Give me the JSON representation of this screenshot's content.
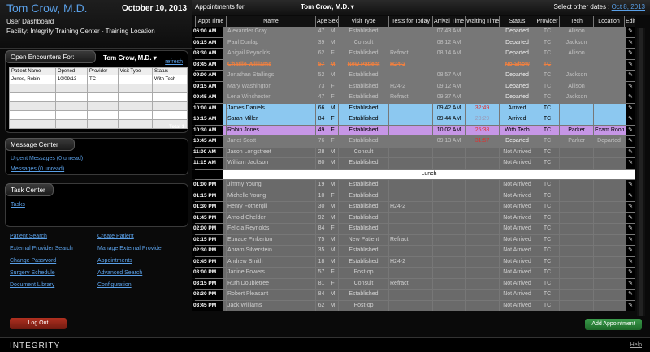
{
  "header": {
    "doctor": "Tom Crow, M.D.",
    "date": "October 10, 2013",
    "dashboard": "User Dashboard",
    "facility": "Facility: Integrity Training Center - Training Location"
  },
  "encounters": {
    "title": "Open Encounters For:",
    "provider": "Tom Crow, M.D.",
    "refresh": "refresh",
    "columns": [
      "Patient Name",
      "Opened",
      "Provider",
      "Visit Type",
      "Status"
    ],
    "rows": [
      [
        "Jones, Robin",
        "10/09/13",
        "TC",
        "",
        "With Tech"
      ]
    ],
    "total": "Total 1"
  },
  "message_center": {
    "title": "Message Center",
    "urgent": "Urgent Messages (0 unread)",
    "messages": "Messages (0 unread)"
  },
  "task_center": {
    "title": "Task Center",
    "tasks": "Tasks"
  },
  "links": {
    "col1": [
      "Patient Search",
      "External Provider Search",
      "Change Password",
      "Surgery Schedule",
      "Document Library"
    ],
    "col2": [
      "Create Patient",
      "Manage External Provider",
      "Appointments",
      "Advanced Search",
      "Configuration"
    ]
  },
  "logout": "Log Out",
  "appointments": {
    "for_label": "Appointments for:",
    "provider": "Tom Crow, M.D.",
    "other_dates": "Select other dates :",
    "other_date_link": "Oct 8, 2013",
    "columns": [
      "Appt Time",
      "Name",
      "Age",
      "Sex",
      "Visit Type",
      "Tests for Today",
      "Arrival Time",
      "Waiting Time",
      "Status",
      "Provider",
      "Tech",
      "Location",
      "Edit"
    ],
    "rows": [
      {
        "time": "06:00 AM",
        "name": "Alexander Gray",
        "age": "47",
        "sex": "M",
        "visit": "Established",
        "tests": "",
        "arrival": "07:43 AM",
        "wait": "",
        "status": "Departed",
        "provider": "TC",
        "tech": "Allison",
        "location": "",
        "type": "departed"
      },
      {
        "time": "08:15 AM",
        "name": "Paul Dunlap",
        "age": "39",
        "sex": "M",
        "visit": "Consult",
        "tests": "",
        "arrival": "08:12 AM",
        "wait": "",
        "status": "Departed",
        "provider": "TC",
        "tech": "Jackson",
        "location": "",
        "type": "departed"
      },
      {
        "time": "08:30 AM",
        "name": "Abigail Reynolds",
        "age": "62",
        "sex": "F",
        "visit": "Established",
        "tests": "Refract",
        "arrival": "08:14 AM",
        "wait": "",
        "status": "Departed",
        "provider": "TC",
        "tech": "Allison",
        "location": "",
        "type": "departed"
      },
      {
        "time": "08:45 AM",
        "name": "Charlie Williams",
        "age": "57",
        "sex": "M",
        "visit": "New Patient",
        "tests": "H24-2",
        "arrival": "",
        "wait": "",
        "status": "No-Show",
        "provider": "TC",
        "tech": "",
        "location": "",
        "type": "noshow"
      },
      {
        "time": "09:00 AM",
        "name": "Jonathan Stallings",
        "age": "52",
        "sex": "M",
        "visit": "Established",
        "tests": "",
        "arrival": "08:57 AM",
        "wait": "",
        "status": "Departed",
        "provider": "TC",
        "tech": "Jackson",
        "location": "",
        "type": "departed"
      },
      {
        "time": "09:15 AM",
        "name": "Mary Washington",
        "age": "73",
        "sex": "F",
        "visit": "Established",
        "tests": "H24-2",
        "arrival": "09:12 AM",
        "wait": "",
        "status": "Departed",
        "provider": "TC",
        "tech": "Allison",
        "location": "",
        "type": "departed"
      },
      {
        "time": "09:45 AM",
        "name": "Lena Winchester",
        "age": "47",
        "sex": "F",
        "visit": "Established",
        "tests": "Refract",
        "arrival": "09:37 AM",
        "wait": "",
        "status": "Departed",
        "provider": "TC",
        "tech": "Jackson",
        "location": "",
        "type": "departed"
      },
      {
        "time": "10:00 AM",
        "name": "James Daniels",
        "age": "66",
        "sex": "M",
        "visit": "Established",
        "tests": "",
        "arrival": "09:42 AM",
        "wait": "32:49",
        "status": "Arrived",
        "provider": "TC",
        "tech": "",
        "location": "",
        "type": "arrived"
      },
      {
        "time": "10:15 AM",
        "name": "Sarah Miller",
        "age": "84",
        "sex": "F",
        "visit": "Established",
        "tests": "",
        "arrival": "09:44 AM",
        "wait": "23:29",
        "status": "Arrived",
        "provider": "TC",
        "tech": "",
        "location": "",
        "type": "arrived"
      },
      {
        "time": "10:30 AM",
        "name": "Robin Jones",
        "age": "49",
        "sex": "F",
        "visit": "Established",
        "tests": "",
        "arrival": "10:02 AM",
        "wait": "25:38",
        "status": "With Tech",
        "provider": "TC",
        "tech": "Parker",
        "location": "Exam Room",
        "type": "tech"
      },
      {
        "time": "10:45 AM",
        "name": "Janet Scott",
        "age": "76",
        "sex": "F",
        "visit": "Established",
        "tests": "",
        "arrival": "09:13 AM",
        "wait": "31:57",
        "status": "Departed",
        "provider": "TC",
        "tech": "Parker",
        "location": "Departed",
        "type": "departed"
      },
      {
        "time": "11:00 AM",
        "name": "Jason Longstreet",
        "age": "28",
        "sex": "M",
        "visit": "Consult",
        "tests": "",
        "arrival": "",
        "wait": "",
        "status": "Not Arrived",
        "provider": "TC",
        "tech": "",
        "location": "",
        "type": "not"
      },
      {
        "time": "11:15 AM",
        "name": "William Jackson",
        "age": "80",
        "sex": "M",
        "visit": "Established",
        "tests": "",
        "arrival": "",
        "wait": "",
        "status": "Not Arrived",
        "provider": "TC",
        "tech": "",
        "location": "",
        "type": "not"
      },
      {
        "time": "",
        "name": "Lunch",
        "type": "lunch"
      },
      {
        "time": "01:00 PM",
        "name": "Jimmy Young",
        "age": "19",
        "sex": "M",
        "visit": "Established",
        "tests": "",
        "arrival": "",
        "wait": "",
        "status": "Not Arrived",
        "provider": "TC",
        "tech": "",
        "location": "",
        "type": "not"
      },
      {
        "time": "01:15 PM",
        "name": "Michelle Young",
        "age": "10",
        "sex": "F",
        "visit": "Established",
        "tests": "",
        "arrival": "",
        "wait": "",
        "status": "Not Arrived",
        "provider": "TC",
        "tech": "",
        "location": "",
        "type": "not"
      },
      {
        "time": "01:30 PM",
        "name": "Henry Fothergill",
        "age": "30",
        "sex": "M",
        "visit": "Established",
        "tests": "H24-2",
        "arrival": "",
        "wait": "",
        "status": "Not Arrived",
        "provider": "TC",
        "tech": "",
        "location": "",
        "type": "not"
      },
      {
        "time": "01:45 PM",
        "name": "Arnold Chelder",
        "age": "92",
        "sex": "M",
        "visit": "Established",
        "tests": "",
        "arrival": "",
        "wait": "",
        "status": "Not Arrived",
        "provider": "TC",
        "tech": "",
        "location": "",
        "type": "not"
      },
      {
        "time": "02:00 PM",
        "name": "Felicia Reynolds",
        "age": "84",
        "sex": "F",
        "visit": "Established",
        "tests": "",
        "arrival": "",
        "wait": "",
        "status": "Not Arrived",
        "provider": "TC",
        "tech": "",
        "location": "",
        "type": "not"
      },
      {
        "time": "02:15 PM",
        "name": "Eunace Pinkerton",
        "age": "75",
        "sex": "M",
        "visit": "New Patient",
        "tests": "Refract",
        "arrival": "",
        "wait": "",
        "status": "Not Arrived",
        "provider": "TC",
        "tech": "",
        "location": "",
        "type": "not"
      },
      {
        "time": "02:30 PM",
        "name": "Abram Silverstein",
        "age": "35",
        "sex": "M",
        "visit": "Established",
        "tests": "",
        "arrival": "",
        "wait": "",
        "status": "Not Arrived",
        "provider": "TC",
        "tech": "",
        "location": "",
        "type": "not"
      },
      {
        "time": "02:45 PM",
        "name": "Andrew Smith",
        "age": "18",
        "sex": "M",
        "visit": "Established",
        "tests": "H24-2",
        "arrival": "",
        "wait": "",
        "status": "Not Arrived",
        "provider": "TC",
        "tech": "",
        "location": "",
        "type": "not"
      },
      {
        "time": "03:00 PM",
        "name": "Janine Powers",
        "age": "57",
        "sex": "F",
        "visit": "Post-op",
        "tests": "",
        "arrival": "",
        "wait": "",
        "status": "Not Arrived",
        "provider": "TC",
        "tech": "",
        "location": "",
        "type": "not"
      },
      {
        "time": "03:15 PM",
        "name": "Ruth Doubletree",
        "age": "81",
        "sex": "F",
        "visit": "Consult",
        "tests": "Refract",
        "arrival": "",
        "wait": "",
        "status": "Not Arrived",
        "provider": "TC",
        "tech": "",
        "location": "",
        "type": "not"
      },
      {
        "time": "03:30 PM",
        "name": "Robert Pleasant",
        "age": "84",
        "sex": "M",
        "visit": "Established",
        "tests": "",
        "arrival": "",
        "wait": "",
        "status": "Not Arrived",
        "provider": "TC",
        "tech": "",
        "location": "",
        "type": "not"
      },
      {
        "time": "03:45 PM",
        "name": "Jack Williams",
        "age": "62",
        "sex": "M",
        "visit": "Post-op",
        "tests": "",
        "arrival": "",
        "wait": "",
        "status": "Not Arrived",
        "provider": "TC",
        "tech": "",
        "location": "",
        "type": "not"
      }
    ]
  },
  "add_appointment": "Add Appointment",
  "footer": {
    "brand": "INTEGRITY",
    "help": "Help"
  }
}
